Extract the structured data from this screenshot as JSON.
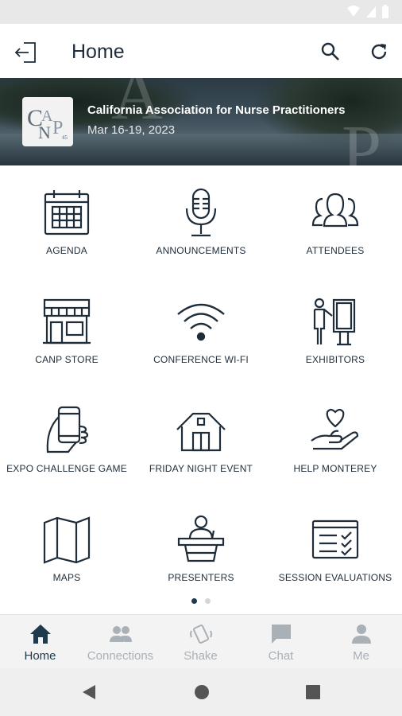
{
  "app_bar": {
    "title": "Home"
  },
  "banner": {
    "org_name": "California Association for Nurse Practitioners",
    "dates": "Mar 16-19, 2023",
    "logo": {
      "letters": "CANP",
      "number": "45"
    }
  },
  "tiles": [
    {
      "label": "AGENDA",
      "icon": "calendar-icon"
    },
    {
      "label": "ANNOUNCEMENTS",
      "icon": "microphone-icon"
    },
    {
      "label": "ATTENDEES",
      "icon": "people-icon"
    },
    {
      "label": "CANP STORE",
      "icon": "storefront-icon"
    },
    {
      "label": "CONFERENCE WI-FI",
      "icon": "wifi-icon"
    },
    {
      "label": "EXHIBITORS",
      "icon": "presenter-board-icon"
    },
    {
      "label": "EXPO CHALLENGE GAME",
      "icon": "phone-in-hand-icon"
    },
    {
      "label": "FRIDAY NIGHT EVENT",
      "icon": "barn-icon"
    },
    {
      "label": "HELP MONTEREY",
      "icon": "heart-in-hand-icon"
    },
    {
      "label": "MAPS",
      "icon": "map-icon"
    },
    {
      "label": "PRESENTERS",
      "icon": "podium-icon"
    },
    {
      "label": "SESSION EVALUATIONS",
      "icon": "checklist-icon"
    }
  ],
  "pager": {
    "pages": 2,
    "current": 1
  },
  "bottom_nav": [
    {
      "label": "Home",
      "icon": "home-icon",
      "active": true
    },
    {
      "label": "Connections",
      "icon": "connections-icon",
      "active": false
    },
    {
      "label": "Shake",
      "icon": "shake-phone-icon",
      "active": false
    },
    {
      "label": "Chat",
      "icon": "chat-icon",
      "active": false
    },
    {
      "label": "Me",
      "icon": "person-icon",
      "active": false
    }
  ],
  "colors": {
    "primary": "#1f3a4a",
    "icon_stroke": "#1f2d3a",
    "inactive": "#a9b0b6"
  }
}
